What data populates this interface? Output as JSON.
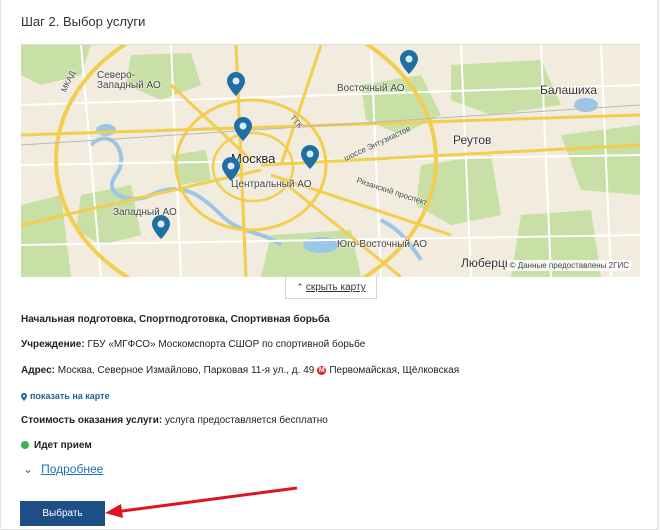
{
  "step": {
    "title": "Шаг 2. Выбор услуги"
  },
  "map": {
    "labels": {
      "moscow": "Москва",
      "balashikha": "Балашиха",
      "reutov": "Реутов",
      "lyubertsy": "Люберцы",
      "sz_ao": "Северо-\nЗападный АО",
      "v_ao": "Восточный АО",
      "c_ao": "Центральный АО",
      "z_ao": "Западный АО",
      "yuv_ao": "Юго-Восточный АО",
      "enthusiasts": "шоссе Энтузиастов",
      "ryazan": "Рязанский проспект",
      "mkad": "МКАД",
      "ttk": "ТТК"
    },
    "copyright": "© Данные предоставлены 2ГИС"
  },
  "toggle_map": {
    "label": "скрыть карту"
  },
  "service": {
    "name": "Начальная подготовка, Спортподготовка, Спортивная борьба",
    "org_label": "Учреждение:",
    "org_value": "ГБУ «МГФСО» Москомспорта СШОР по спортивной борьбе",
    "address_label": "Адрес:",
    "address_value": "Москва, Северное Измайлово, Парковая 11-я ул., д. 49",
    "metro_icon": "metro-icon",
    "metro_value": "Первомайская, Щёлковская",
    "show_on_map": "показать на карте",
    "cost_label": "Стоимость оказания услуги:",
    "cost_value": "услуга предоставляется бесплатно",
    "status": "Идет прием",
    "status_color": "#3cb54a",
    "more": "Подробнее"
  },
  "actions": {
    "select": "Выбрать",
    "select_color": "#1d4f86"
  },
  "annotation": {
    "arrow_color": "#e0141e"
  }
}
